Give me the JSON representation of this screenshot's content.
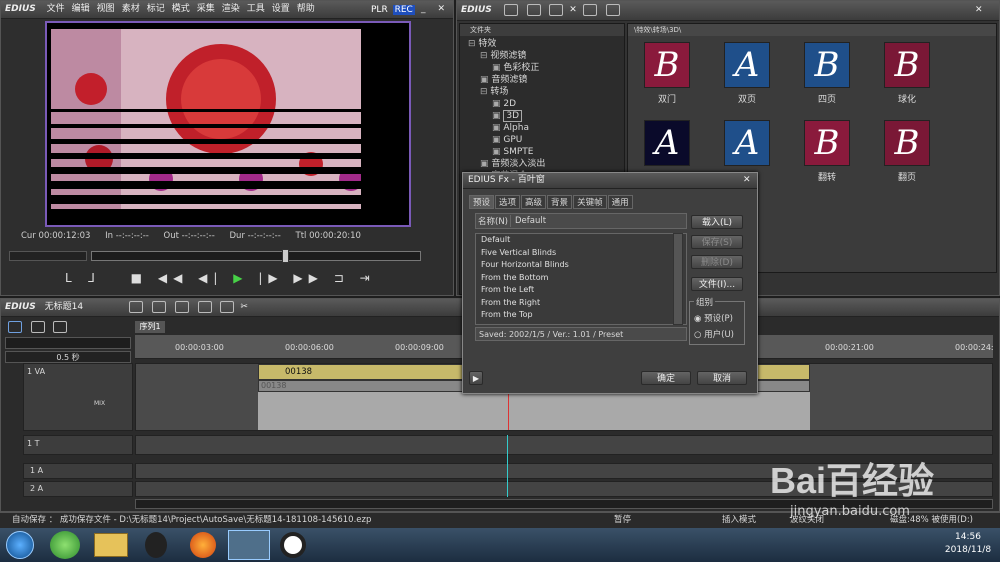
{
  "app_name": "EDIUS",
  "menu": [
    "文件",
    "编辑",
    "视图",
    "素材",
    "标记",
    "模式",
    "采集",
    "渲染",
    "工具",
    "设置",
    "帮助"
  ],
  "player": {
    "plr": "PLR",
    "rec": "REC",
    "cur_label": "Cur",
    "cur": "00:00:12:03",
    "in_label": "In",
    "in": "--:--:--:--",
    "out_label": "Out",
    "out": "--:--:--:--",
    "dur_label": "Dur",
    "dur": "--:--:--:--",
    "ttl_label": "Ttl",
    "ttl": "00:00:20:10"
  },
  "bin": {
    "title": "EDIUS",
    "tree_header": "文件夹",
    "path": "\\特效\\转场\\3D\\",
    "tree": [
      {
        "label": "特效",
        "indent": 0,
        "expanded": true
      },
      {
        "label": "视频滤镜",
        "indent": 1,
        "expanded": true
      },
      {
        "label": "色彩校正",
        "indent": 2
      },
      {
        "label": "音频滤镜",
        "indent": 1
      },
      {
        "label": "转场",
        "indent": 1,
        "expanded": true
      },
      {
        "label": "2D",
        "indent": 2
      },
      {
        "label": "3D",
        "indent": 2,
        "selected": true
      },
      {
        "label": "Alpha",
        "indent": 2
      },
      {
        "label": "GPU",
        "indent": 2
      },
      {
        "label": "SMPTE",
        "indent": 2
      },
      {
        "label": "音频淡入淡出",
        "indent": 1
      },
      {
        "label": "字幕混合",
        "indent": 1
      }
    ],
    "tiles": [
      {
        "label": "双门",
        "glyph": "B",
        "color": "#8a1a3c"
      },
      {
        "label": "双页",
        "glyph": "A",
        "color": "#1f4f8a"
      },
      {
        "label": "四页",
        "glyph": "B",
        "color": "#1f4f8a"
      },
      {
        "label": "球化",
        "glyph": "B",
        "color": "#7a1836"
      },
      {
        "label": "",
        "glyph": "A",
        "color": "#0a0a2a"
      },
      {
        "label": "",
        "glyph": "A",
        "color": "#1f4f8a"
      },
      {
        "label": "翻转",
        "glyph": "B",
        "color": "#8a1a3c"
      },
      {
        "label": "翻页",
        "glyph": "B",
        "color": "#7a1836"
      }
    ]
  },
  "dialog": {
    "title": "EDIUS Fx - 百叶窗",
    "tabs": [
      "预设",
      "选项",
      "高级",
      "背景",
      "关键帧",
      "通用"
    ],
    "name_label": "名称(N)",
    "name_value": "Default",
    "presets": [
      "Default",
      "Five Vertical Blinds",
      "Four Horizontal Blinds",
      "From the Bottom",
      "From the Left",
      "From the Right",
      "From the Top",
      "Multi Open"
    ],
    "saved_info": "Saved: 2002/1/5 / Ver.: 1.01 / Preset",
    "load_button": "载入(L)",
    "save_button": "保存(S)",
    "delete_button": "删除(D)",
    "file_button": "文件(I)...",
    "group_label": "组别",
    "radio_preset": "预设(P)",
    "radio_user": "用户(U)",
    "ok_button": "确定",
    "cancel_button": "取消"
  },
  "timeline": {
    "title": "EDIUS",
    "project": "无标题14",
    "sequence_tab": "序列1",
    "scale": "0.5 秒",
    "ruler": [
      "00:00:03:00",
      "00:00:06:00",
      "00:00:09:00",
      "00:00:21:00",
      "00:00:24:"
    ],
    "tracks": [
      {
        "name": "1 VA",
        "tag": "MIX"
      },
      {
        "name": "1 T"
      },
      {
        "name": "1 A"
      },
      {
        "name": "2 A"
      }
    ],
    "clip_name": "00138",
    "clip_sub": "00138"
  },
  "statusbar": {
    "autosave": "自动保存 ： 成功保存文件 - D:\\无标题14\\Project\\AutoSave\\无标题14-181108-145610.ezp",
    "pause": "暂停",
    "insert_mode": "插入模式",
    "ripple": "波纹关闭",
    "disk": "磁盘:48% 被使用(D:)"
  },
  "taskbar": {
    "time": "14:56",
    "date": "2018/11/8"
  },
  "watermark": {
    "text": "Bai百经验",
    "url": "jingyan.baidu.com"
  }
}
